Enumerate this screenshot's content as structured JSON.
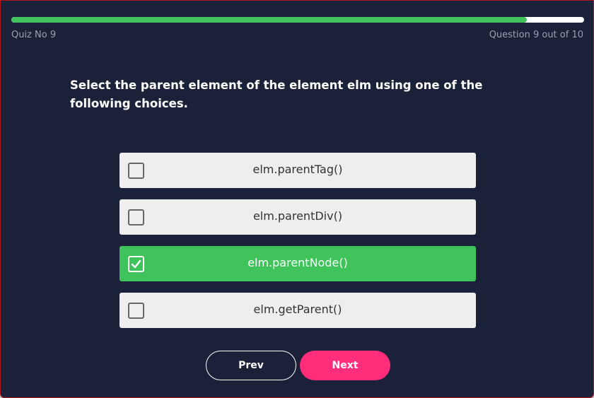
{
  "header": {
    "quiz_label": "Quiz No 9",
    "question_count": "Question 9 out of 10",
    "progress": 0.9
  },
  "question": {
    "text": "Select the parent element of the element elm using one of the following choices."
  },
  "options": [
    {
      "label": "elm.parentTag()",
      "checked": false
    },
    {
      "label": "elm.parentDiv()",
      "checked": false
    },
    {
      "label": "elm.parentNode()",
      "checked": true
    },
    {
      "label": "elm.getParent()",
      "checked": false
    }
  ],
  "buttons": {
    "prev_label": "Prev",
    "next_label": "Next"
  },
  "colors": {
    "background": "#1b2138",
    "accent_green": "#3fc35a",
    "next_pink": "#ff2d7a"
  }
}
